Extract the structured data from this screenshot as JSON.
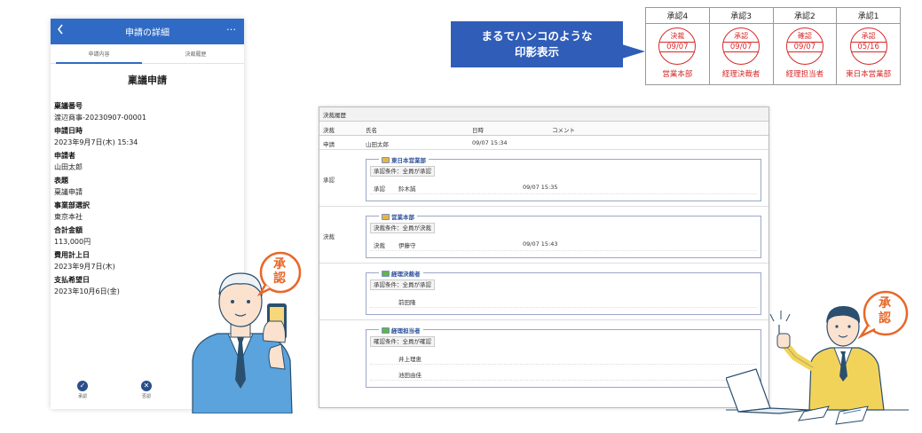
{
  "phone": {
    "header_title": "申請の詳細",
    "back_icon": "chevron-left-icon",
    "more_label": "…",
    "tabs": [
      {
        "label": "申請内容"
      },
      {
        "label": "決裁履歴"
      }
    ],
    "form_title": "稟議申請",
    "fields": [
      {
        "label": "稟議番号",
        "value": "渡辺商事-20230907-00001"
      },
      {
        "label": "申請日時",
        "value": "2023年9月7日(木) 15:34"
      },
      {
        "label": "申請者",
        "value": "山田太郎"
      },
      {
        "label": "表題",
        "value": "稟議申請"
      },
      {
        "label": "事業部選択",
        "value": "東京本社"
      },
      {
        "label": "合計金額",
        "value": "113,000円"
      },
      {
        "label": "費用計上日",
        "value": "2023年9月7日(木)"
      },
      {
        "label": "支払希望日",
        "value": "2023年10月6日(金)"
      }
    ],
    "footer": {
      "approve_label": "承認",
      "reject_label": "否認"
    }
  },
  "callout": {
    "line1": "まるでハンコのような",
    "line2": "印影表示"
  },
  "stamp_table": {
    "columns": [
      {
        "header": "承認4",
        "top": "決裁",
        "date": "09/07",
        "dept": "営業本部"
      },
      {
        "header": "承認3",
        "top": "承認",
        "date": "09/07",
        "dept": "経理決裁者"
      },
      {
        "header": "承認2",
        "top": "確認",
        "date": "09/07",
        "dept": "経理担当者"
      },
      {
        "header": "承認1",
        "top": "承認",
        "date": "05/16",
        "dept": "東日本営業部"
      }
    ],
    "stamp_color": "#d62a2a"
  },
  "history": {
    "title": "決裁履歴",
    "headers": {
      "col_action": "決裁",
      "col_name": "氏名",
      "col_datetime": "日時",
      "col_comment": "コメント"
    },
    "apply_row": {
      "action": "申請",
      "name": "山田太郎",
      "datetime": "09/07 15:34"
    },
    "groups": [
      {
        "row_label": "承認",
        "dept": "東日本営業部",
        "condition": "承認条件：全員が承認",
        "entries": [
          {
            "action": "承認",
            "name": "鈴木誠",
            "datetime": "09/07 15:35"
          }
        ]
      },
      {
        "row_label": "決裁",
        "dept": "営業本部",
        "condition": "決裁条件：全員が決裁",
        "entries": [
          {
            "action": "決裁",
            "name": "伊藤守",
            "datetime": "09/07 15:43"
          }
        ]
      },
      {
        "row_label": "",
        "dept": "経理決裁者",
        "condition": "承認条件：全員が承認",
        "entries": [
          {
            "action": "",
            "name": "前田隆",
            "datetime": ""
          }
        ]
      },
      {
        "row_label": "",
        "dept": "経理担当者",
        "condition": "確認条件：全員が確認",
        "entries": [
          {
            "action": "",
            "name": "井上理恵",
            "datetime": ""
          },
          {
            "action": "",
            "name": "池田由佳",
            "datetime": ""
          }
        ]
      }
    ]
  },
  "bubbles": {
    "left_text_1": "承",
    "left_text_2": "認",
    "right_text_1": "承",
    "right_text_2": "認"
  },
  "colors": {
    "primary_blue": "#2f6bc4",
    "callout_blue": "#2f5db8",
    "stamp_red": "#d62a2a",
    "bubble_orange": "#e8682a"
  }
}
